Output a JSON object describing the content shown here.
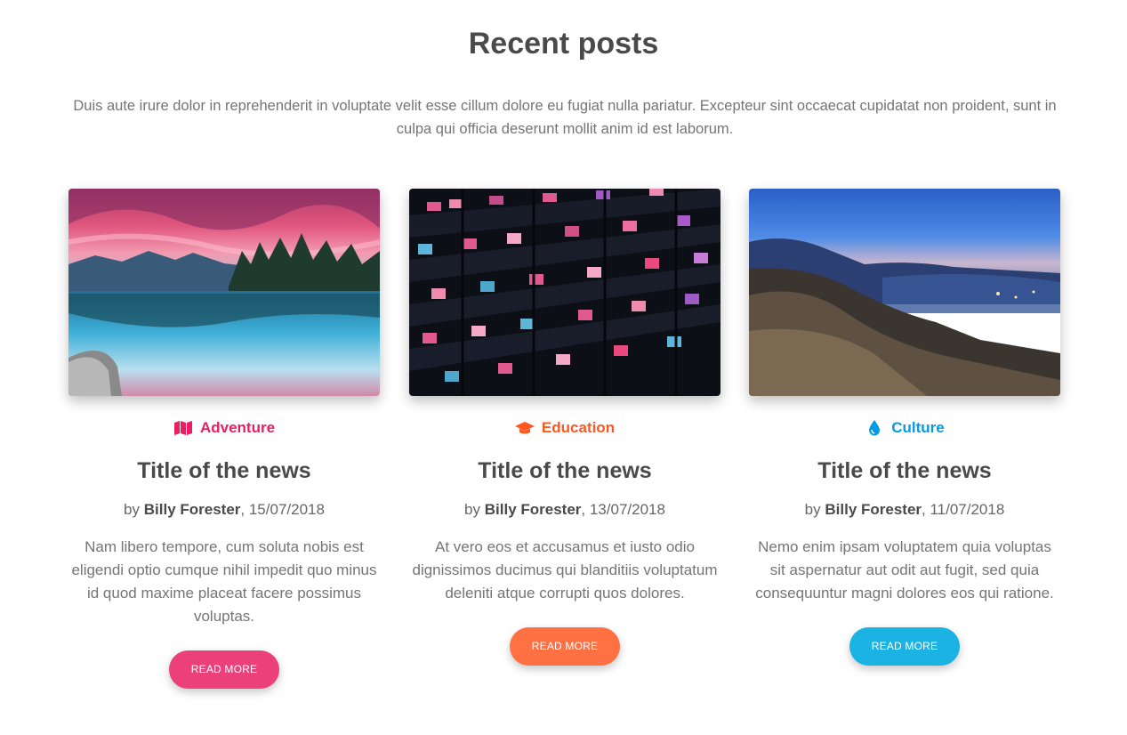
{
  "section": {
    "title": "Recent posts",
    "description": "Duis aute irure dolor in reprehenderit in voluptate velit esse cillum dolore eu fugiat nulla pariatur. Excepteur sint occaecat cupidatat non proident, sunt in culpa qui officia deserunt mollit anim id est laborum."
  },
  "posts": [
    {
      "category": "Adventure",
      "category_icon": "map-icon",
      "category_color": "#e91e63",
      "title": "Title of the news",
      "by_prefix": "by",
      "author": "Billy Forester",
      "date": ", 15/07/2018",
      "excerpt": "Nam libero tempore, cum soluta nobis est eligendi optio cumque nihil impedit quo minus id quod maxime placeat facere possimus voluptas.",
      "button_label": "READ MORE",
      "button_color": "#ec407a",
      "image_alt": "mountain lake at sunset"
    },
    {
      "category": "Education",
      "category_icon": "graduation-cap-icon",
      "category_color": "#ff5722",
      "title": "Title of the news",
      "by_prefix": "by",
      "author": "Billy Forester",
      "date": ", 13/07/2018",
      "excerpt": "At vero eos et accusamus et iusto odio dignissimos ducimus qui blanditiis voluptatum deleniti atque corrupti quos dolores.",
      "button_label": "READ MORE",
      "button_color": "#ff7043",
      "image_alt": "office building at night"
    },
    {
      "category": "Culture",
      "category_icon": "tint-icon",
      "category_color": "#039be5",
      "title": "Title of the news",
      "by_prefix": "by",
      "author": "Billy Forester",
      "date": ", 11/07/2018",
      "excerpt": "Nemo enim ipsam voluptatem quia voluptas sit aspernatur aut odit aut fugit, sed quia consequuntur magni dolores eos qui ratione.",
      "button_label": "READ MORE",
      "button_color": "#1ab3e3",
      "image_alt": "mountain ridge at dusk"
    }
  ]
}
